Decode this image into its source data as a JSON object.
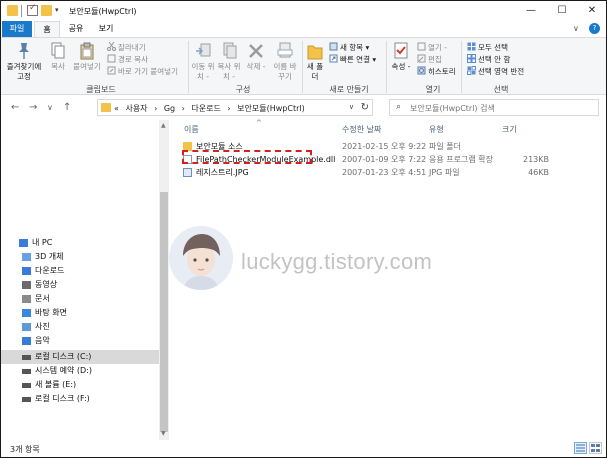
{
  "window": {
    "title": "보안모듈(HwpCtrl)",
    "minimize_glyph": "—",
    "maximize_glyph": "☐",
    "close_glyph": "✕"
  },
  "quick_access": {
    "dropdown_glyph": "▾"
  },
  "tabs": [
    {
      "label": "파일"
    },
    {
      "label": "홈"
    },
    {
      "label": "공유"
    },
    {
      "label": "보기"
    }
  ],
  "ribbon_controls": {
    "collapse_glyph": "∨",
    "help_glyph": "?"
  },
  "ribbon": {
    "clipboard": {
      "group_label": "클립보드",
      "pin_label": "즐겨찾기에 고정",
      "copy_label": "복사",
      "paste_label": "붙여넣기",
      "cut_label": "잘라내기",
      "copy_path_label": "경로 복사",
      "paste_shortcut_label": "바로 가기 붙여넣기"
    },
    "organize": {
      "group_label": "구성",
      "move_label": "이동 위치 -",
      "copyto_label": "복사 위치 -",
      "delete_label": "삭제 -",
      "rename_label": "이름 바꾸기"
    },
    "new": {
      "group_label": "새로 만들기",
      "newfolder_label": "새 폴더",
      "newitem_label": "새 항목 ▾",
      "easyaccess_label": "빠른 연결 ▾"
    },
    "open": {
      "group_label": "열기",
      "properties_label": "속성 -",
      "open_label": "열기 -",
      "edit_label": "편집",
      "history_label": "히스토리"
    },
    "select": {
      "group_label": "선택",
      "selectall_label": "모두 선택",
      "selectnone_label": "선택 안 함",
      "invert_label": "선택 영역 반전"
    }
  },
  "nav": {
    "back": "←",
    "forward": "→",
    "recent": "∨",
    "up": "↑"
  },
  "address": {
    "overflow": "«",
    "crumbs": [
      "사용자",
      "Gg",
      "다운로드",
      "보안모듈(HwpCtrl)"
    ],
    "separator": "›",
    "dropdown": "∨",
    "refresh": "↻"
  },
  "search": {
    "icon": "⌕",
    "placeholder": "보안모듈(HwpCtrl) 검색"
  },
  "navpane": {
    "items": [
      {
        "label": "내 PC",
        "icon": "pc-icon"
      },
      {
        "label": "3D 개체",
        "icon": "3d-objects-icon"
      },
      {
        "label": "다운로드",
        "icon": "download-icon"
      },
      {
        "label": "동영상",
        "icon": "video-icon"
      },
      {
        "label": "문서",
        "icon": "document-icon"
      },
      {
        "label": "바탕 화면",
        "icon": "desktop-icon"
      },
      {
        "label": "사진",
        "icon": "pictures-icon"
      },
      {
        "label": "음악",
        "icon": "music-icon"
      },
      {
        "label": "로컬 디스크 (C:)",
        "icon": "drive-c-icon"
      },
      {
        "label": "시스템 예약 (D:)",
        "icon": "drive-d-icon"
      },
      {
        "label": "새 볼륨 (E:)",
        "icon": "drive-e-icon"
      },
      {
        "label": "로컬 디스크 (F:)",
        "icon": "drive-f-icon"
      }
    ],
    "selected": "로컬 디스크 (C:)"
  },
  "columns": {
    "name": "이름",
    "date": "수정한 날짜",
    "type": "유형",
    "size": "크기",
    "sort_glyph": "^"
  },
  "files": [
    {
      "name": "보안모듈 소스",
      "date": "2021-02-15 오후 9:22",
      "type": "파일 폴더",
      "size": "",
      "icon": "folder-icon"
    },
    {
      "name": "FilePathCheckerModuleExample.dll",
      "date": "2007-01-09 오후 7:22",
      "type": "응용 프로그램 확장",
      "size": "213KB",
      "icon": "dll-file-icon"
    },
    {
      "name": "레지스트리.JPG",
      "date": "2007-01-23 오후 4:51",
      "type": "JPG 파일",
      "size": "46KB",
      "icon": "jpg-file-icon"
    }
  ],
  "watermark": {
    "text": "luckygg.tistory.com"
  },
  "status": {
    "count": "3개 항목"
  },
  "colors": {
    "accent": "#1979ca",
    "folder": "#f2c24a",
    "highlight_box": "#d4201f",
    "header_text": "#4c607a"
  }
}
